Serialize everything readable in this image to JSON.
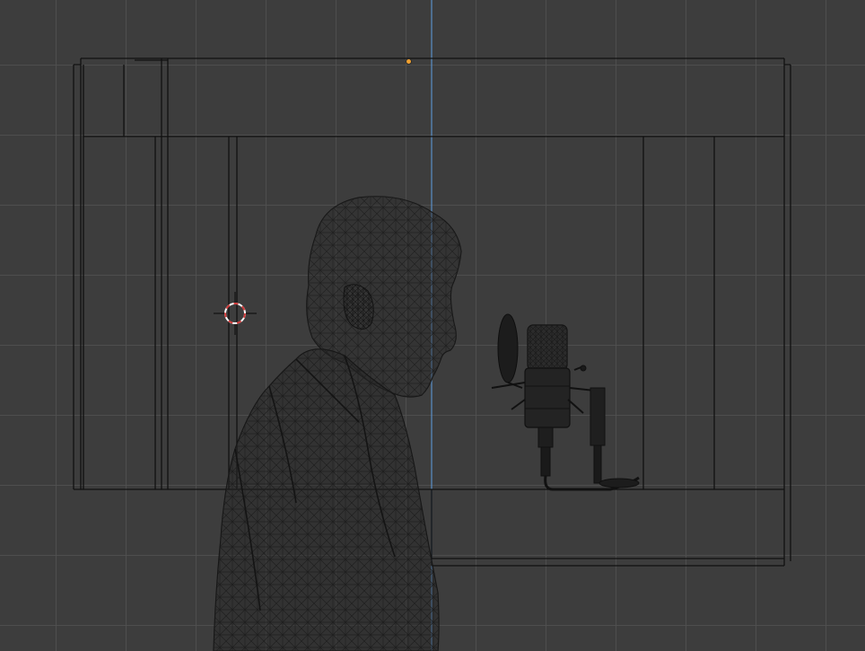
{
  "viewport": {
    "background_color": "#3d3d3d",
    "grid_color": "#505050",
    "axis_line_color": "#5b8fc7",
    "wire_color": "#111111",
    "mesh_wire_color": "#1a1a1a",
    "origin_color": "#f0a030",
    "cursor_colors": [
      "#ffffff",
      "#d03a3a"
    ]
  },
  "objects": {
    "room": "room-wireframe",
    "person": "person-wireframe-mesh",
    "microphone": "microphone-stand-wireframe"
  },
  "icons": {
    "cursor": "3d-cursor-icon",
    "origin": "object-origin-dot"
  }
}
